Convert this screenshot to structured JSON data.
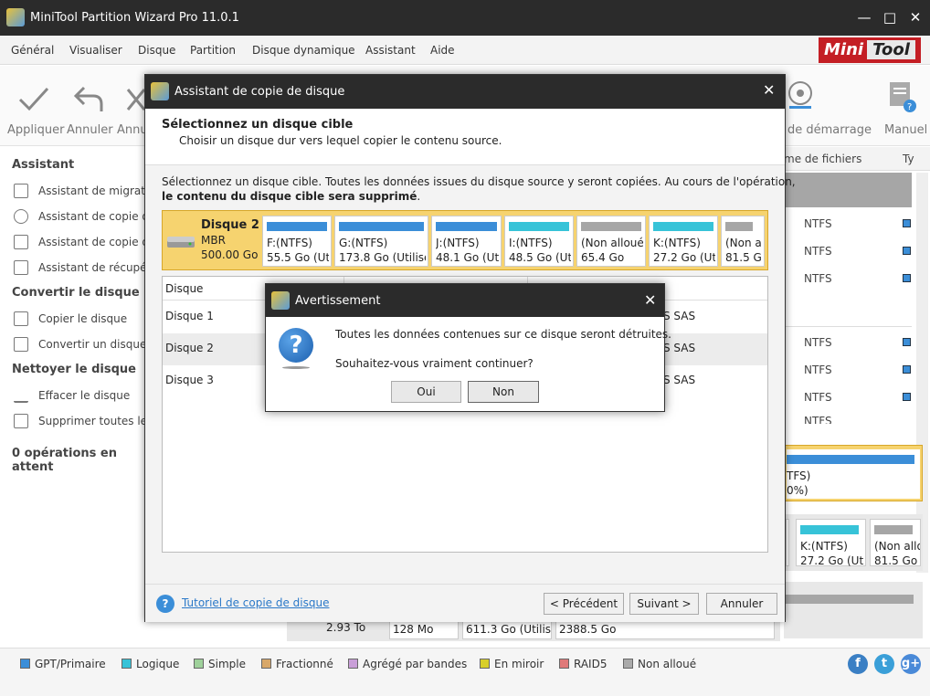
{
  "window": {
    "title": "MiniTool Partition Wizard Pro 11.0.1"
  },
  "menu": [
    "Général",
    "Visualiser",
    "Disque",
    "Partition",
    "Disque dynamique",
    "Assistant",
    "Aide"
  ],
  "logo": {
    "mini": "Mini",
    "tool": "Tool"
  },
  "toolbar": {
    "apply": "Appliquer",
    "undo": "Annuler",
    "discard": "Annu",
    "boot": "de démarrage",
    "manual": "Manuel"
  },
  "sidebar": {
    "assistant_title": "Assistant",
    "assistant_items": [
      "Assistant de migratio",
      "Assistant de copie d",
      "Assistant de copie d",
      "Assistant de récupér"
    ],
    "convert_title": "Convertir le disque",
    "convert_items": [
      "Copier le disque",
      "Convertir un disque"
    ],
    "clean_title": "Nettoyer le disque",
    "clean_items": [
      "Effacer le disque",
      "Supprimer toutes les"
    ],
    "ops": "0 opérations en attent"
  },
  "right_panel": {
    "header_fs": "me de fichiers",
    "header_ty": "Ty",
    "rows": [
      "NTFS",
      "NTFS",
      "NTFS",
      "NTFS",
      "NTFS",
      "NTFS",
      "NTFS"
    ],
    "disk_tail_a": "TFS)",
    "disk_tail_b": "0%)",
    "k_label": "K:(NTFS)",
    "k_size": "27.2 Go (Uti",
    "na_label": "(Non allo",
    "na_size": "81.5 Go"
  },
  "bottom_disk": {
    "size": "2.93 To",
    "p1": "128 Mo",
    "p2": "611.3 Go (Utilisé",
    "p3": "2388.5 Go"
  },
  "legend": [
    "GPT/Primaire",
    "Logique",
    "Simple",
    "Fractionné",
    "Agrégé par bandes",
    "En miroir",
    "RAID5",
    "Non alloué"
  ],
  "legend_colors": [
    "#3b8ed8",
    "#37c3d8",
    "#9fd19b",
    "#d8a86a",
    "#c99fd8",
    "#d8cf2a",
    "#e07a7a",
    "#aaaaaa"
  ],
  "dialog": {
    "title": "Assistant de copie de disque",
    "heading": "Sélectionnez un disque cible",
    "subheading": "Choisir un disque dur vers lequel copier le contenu source.",
    "info_1": "Sélectionnez un disque cible. Toutes les données issues du disque source y seront copiées. Au cours de l'opération,",
    "info_2": "le contenu du disque cible sera supprimé",
    "info_3": ".",
    "disk": {
      "name": "Disque 2",
      "type": "MBR",
      "size": "500.00 Go"
    },
    "partitions": [
      {
        "label": "F:(NTFS)",
        "size": "55.5 Go (Uti",
        "color": "#3b8ed8"
      },
      {
        "label": "G:(NTFS)",
        "size": "173.8 Go (Utilisé",
        "color": "#3b8ed8"
      },
      {
        "label": "J:(NTFS)",
        "size": "48.1 Go (Uti",
        "color": "#3b8ed8"
      },
      {
        "label": "I:(NTFS)",
        "size": "48.5 Go (Uti",
        "color": "#37c3d8"
      },
      {
        "label": "(Non alloué)",
        "size": "65.4 Go",
        "color": "#a6a6a6"
      },
      {
        "label": "K:(NTFS)",
        "size": "27.2 Go (Uti",
        "color": "#37c3d8"
      },
      {
        "label": "(Non a",
        "size": "81.5 Go",
        "color": "#a6a6a6"
      }
    ],
    "table_header": "Disque",
    "rows": [
      {
        "name": "Disque 1",
        "tail": "S SAS"
      },
      {
        "name": "Disque 2",
        "tail": "S SAS"
      },
      {
        "name": "Disque 3",
        "tail": "S SAS"
      }
    ],
    "tutorial": "Tutoriel de copie de disque",
    "prev": "< Précédent",
    "next": "Suivant >",
    "cancel": "Annuler"
  },
  "warning": {
    "title": "Avertissement",
    "message": "Toutes les données contenues sur ce disque seront détruites.",
    "question": "Souhaitez-vous vraiment continuer?",
    "yes": "Oui",
    "no": "Non"
  }
}
